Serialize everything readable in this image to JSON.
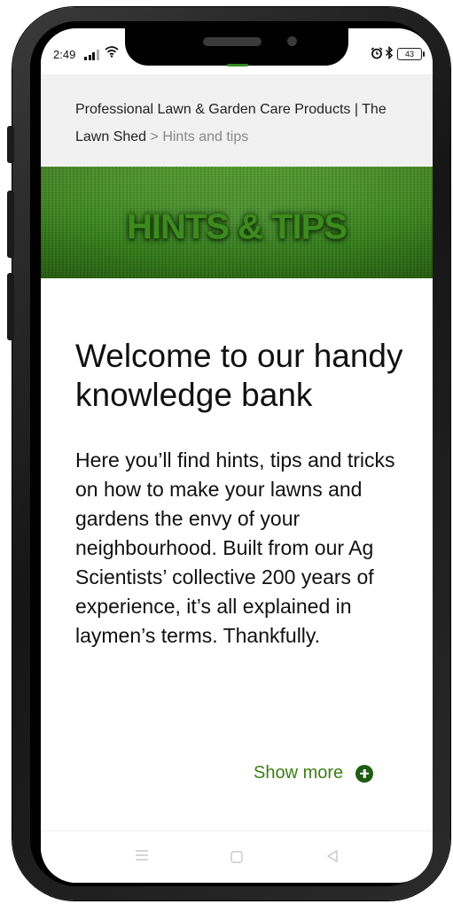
{
  "status_bar": {
    "time": "2:49",
    "battery": "43",
    "icons": [
      "signal-icon",
      "wifi-icon",
      "alarm-icon",
      "bluetooth-icon",
      "battery-icon"
    ]
  },
  "breadcrumb": {
    "home": "Professional Lawn & Garden Care Products | The Lawn Shed",
    "separator": ">",
    "current": "Hints and tips"
  },
  "banner": {
    "title": "HINTS & TIPS"
  },
  "main": {
    "heading": "Welcome to our handy knowledge bank",
    "body": "Here you’ll find hints, tips and tricks on how to make your lawns and gardens the envy of your neighbourhood. Built from our Ag Scientists’ collective 200 years of experience, it’s all explained in laymen’s terms. Thankfully.",
    "show_more": "Show more"
  },
  "nav_bar": {
    "icons": [
      "menu-icon",
      "home-icon",
      "back-icon"
    ]
  },
  "colors": {
    "accent": "#3c7d16",
    "accent_dark": "#1f5e12",
    "breadcrumb_bg": "#f1f1f1",
    "grass": "#3f8b1f"
  }
}
